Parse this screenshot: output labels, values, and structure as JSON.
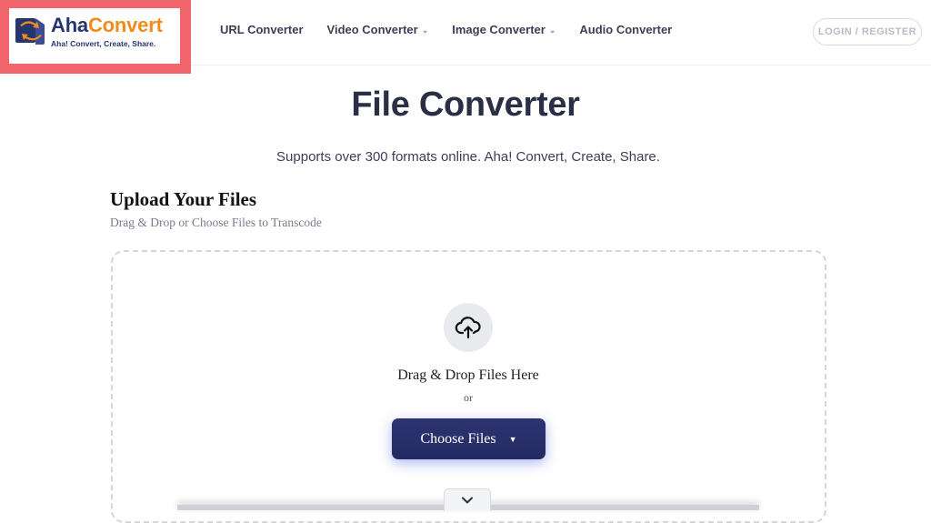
{
  "brand": {
    "name_part1": "Aha",
    "name_part2": "Convert",
    "tagline": "Aha! Convert, Create, Share.",
    "colors": {
      "primary": "#243570",
      "accent": "#f28b1c",
      "highlight_frame": "#f0666c"
    }
  },
  "nav": {
    "items": [
      {
        "label": "URL Converter",
        "has_dropdown": false
      },
      {
        "label": "Video Converter",
        "has_dropdown": true
      },
      {
        "label": "Image Converter",
        "has_dropdown": true
      },
      {
        "label": "Audio Converter",
        "has_dropdown": false
      }
    ],
    "login_label": "LOGIN / REGISTER"
  },
  "hero": {
    "title": "File Converter",
    "subtitle": "Supports over 300 formats online. Aha! Convert, Create, Share."
  },
  "upload": {
    "heading": "Upload Your Files",
    "caption": "Drag & Drop or Choose Files to Transcode",
    "drop_text": "Drag & Drop Files Here",
    "or_text": "or",
    "choose_label": "Choose Files",
    "icons": {
      "upload": "cloud-upload-icon",
      "caret": "caret-down-icon",
      "expand": "chevron-down-icon"
    },
    "button_color": "#262d68"
  }
}
